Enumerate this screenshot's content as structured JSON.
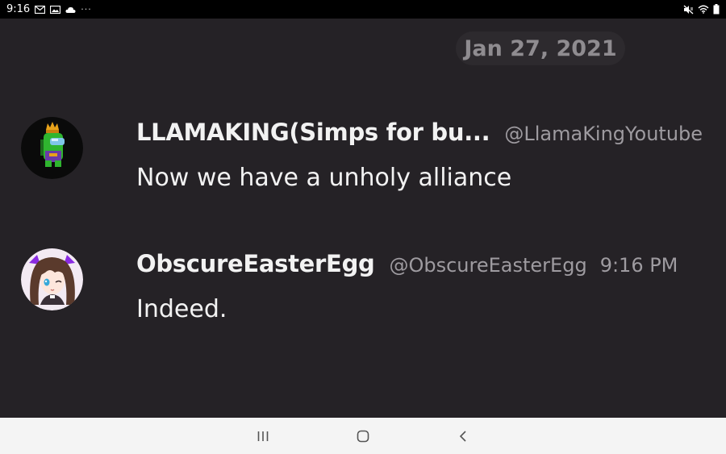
{
  "status_bar": {
    "time": "9:16",
    "overflow": "···",
    "icons_left": [
      "gmail-icon",
      "gallery-icon",
      "cloud-icon"
    ],
    "icons_right": [
      "mute-icon",
      "wifi-icon",
      "battery-icon"
    ]
  },
  "chat": {
    "date_divider": "Jan 27, 2021",
    "messages": [
      {
        "username": "LLAMAKING(Simps for bu...",
        "handle": "@LlamaKingYoutube",
        "time": "",
        "text": "Now we have a unholy alliance",
        "avatar": "crewmate-avatar"
      },
      {
        "username": "ObscureEasterEgg",
        "handle": "@ObscureEasterEgg",
        "time": "9:16 PM",
        "text": "Indeed.",
        "avatar": "anime-girl-avatar"
      }
    ]
  },
  "nav_bar": {
    "buttons": [
      "recents-icon",
      "home-icon",
      "back-icon"
    ]
  },
  "colors": {
    "chat_background": "#252226",
    "text_primary": "#f2f2f2",
    "text_secondary": "#9e9ba0",
    "date_text": "#8f8c90"
  }
}
